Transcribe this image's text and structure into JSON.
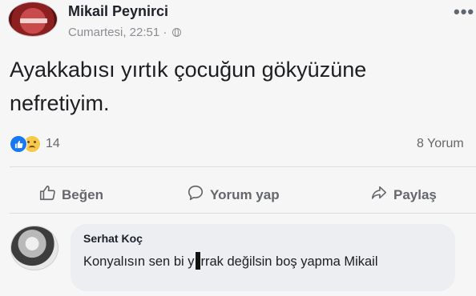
{
  "post": {
    "author": "Mikail Peynirci",
    "timestamp": "Cumartesi, 22:51 ·",
    "text": "Ayakkabısı yırtık çocuğun gökyüzüne nefretiyim.",
    "reaction_count": "14",
    "comments_count": "8 Yorum",
    "more_icon": "more-options-icon"
  },
  "actions": {
    "like_label": "Beğen",
    "comment_label": "Yorum yap",
    "share_label": "Paylaş"
  },
  "comment": {
    "author": "Serhat Koç",
    "text_before": "Konyalısın sen bi y",
    "text_after": "rrak değilsin boş yapma Mikail"
  },
  "colors": {
    "like_blue": "#1877f2",
    "muted_text": "#65676b",
    "bubble_bg": "#eceef1"
  }
}
